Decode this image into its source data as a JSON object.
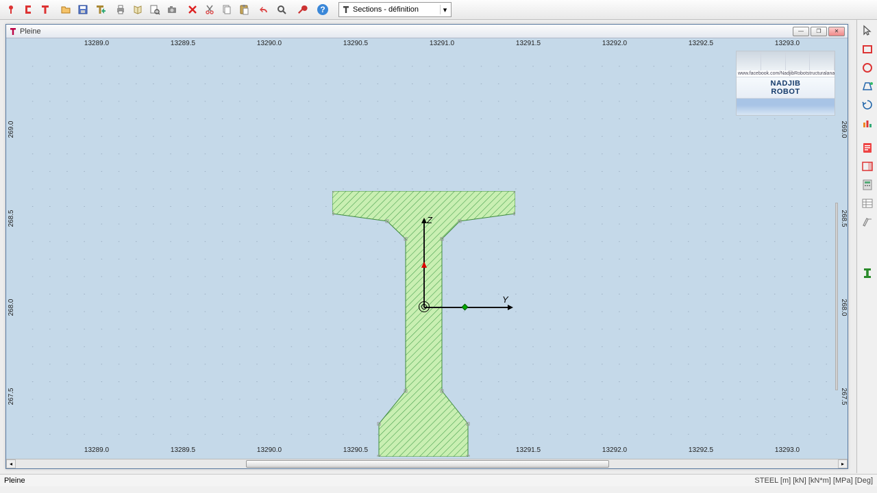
{
  "layout_selector": {
    "label": "Sections - définition"
  },
  "document": {
    "title": "Pleine"
  },
  "watermark": {
    "line1": "NADJIB",
    "line2": "ROBOT",
    "caption": "www.facebook.com/NadjibRobotstructuralanalysisproblems"
  },
  "ruler_x": {
    "ticks": [
      "13289.0",
      "13289.5",
      "13290.0",
      "13290.5",
      "13291.0",
      "13291.5",
      "13292.0",
      "13292.5",
      "13293.0"
    ]
  },
  "ruler_y": {
    "ticks": [
      "269.0",
      "268.5",
      "268.0",
      "267.5"
    ]
  },
  "axis": {
    "y_label": "Y",
    "z_label": "Z"
  },
  "status": {
    "left": "Pleine",
    "right": "STEEL   [m] [kN] [kN*m] [MPa] [Deg]"
  },
  "colors": {
    "canvas": "#c5d9e9",
    "section_fill": "#c9efb2",
    "section_stroke": "#49a24f"
  }
}
